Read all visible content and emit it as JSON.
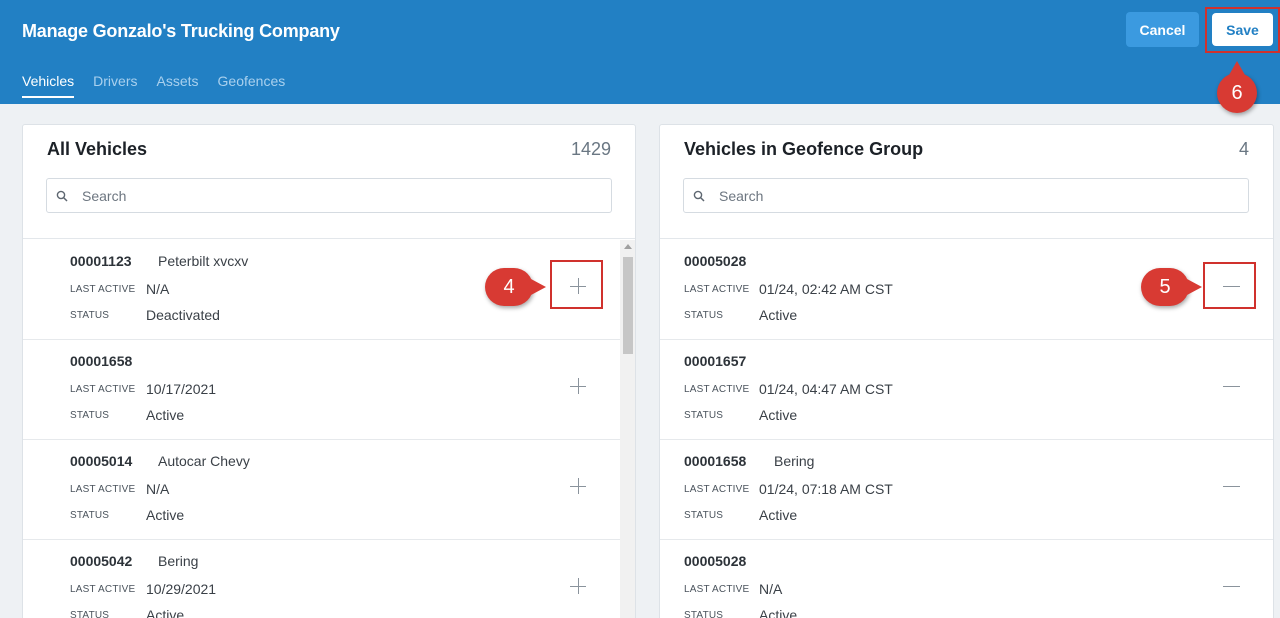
{
  "header": {
    "title": "Manage Gonzalo's Trucking Company",
    "tabs": [
      {
        "label": "Vehicles",
        "active": true
      },
      {
        "label": "Drivers",
        "active": false
      },
      {
        "label": "Assets",
        "active": false
      },
      {
        "label": "Geofences",
        "active": false
      }
    ],
    "cancel_label": "Cancel",
    "save_label": "Save"
  },
  "left_panel": {
    "title": "All Vehicles",
    "count": "1429",
    "search_placeholder": "Search",
    "last_active_label": "LAST ACTIVE",
    "status_label": "STATUS",
    "rows": [
      {
        "id": "00001123",
        "name": "Peterbilt xvcxv",
        "last_active": "N/A",
        "status": "Deactivated"
      },
      {
        "id": "00001658",
        "name": "",
        "last_active": "10/17/2021",
        "status": "Active"
      },
      {
        "id": "00005014",
        "name": "Autocar Chevy",
        "last_active": "N/A",
        "status": "Active"
      },
      {
        "id": "00005042",
        "name": "Bering",
        "last_active": "10/29/2021",
        "status": "Active"
      }
    ]
  },
  "right_panel": {
    "title": "Vehicles in Geofence Group",
    "count": "4",
    "search_placeholder": "Search",
    "last_active_label": "LAST ACTIVE",
    "status_label": "STATUS",
    "rows": [
      {
        "id": "00005028",
        "name": "",
        "last_active": "01/24, 02:42 AM CST",
        "status": "Active"
      },
      {
        "id": "00001657",
        "name": "",
        "last_active": "01/24, 04:47 AM CST",
        "status": "Active"
      },
      {
        "id": "00001658",
        "name": "Bering",
        "last_active": "01/24, 07:18 AM CST",
        "status": "Active"
      },
      {
        "id": "00005028",
        "name": "",
        "last_active": "N/A",
        "status": "Active"
      }
    ]
  },
  "annotations": {
    "step_4": "4",
    "step_5": "5",
    "step_6": "6",
    "color": "#d83a33"
  },
  "icons": {
    "search": "search-icon",
    "add": "plus-icon",
    "remove": "minus-icon"
  },
  "colors": {
    "header_bg": "#2280c4",
    "cancel_bg": "#3b9ae0",
    "save_text": "#2280c4"
  }
}
